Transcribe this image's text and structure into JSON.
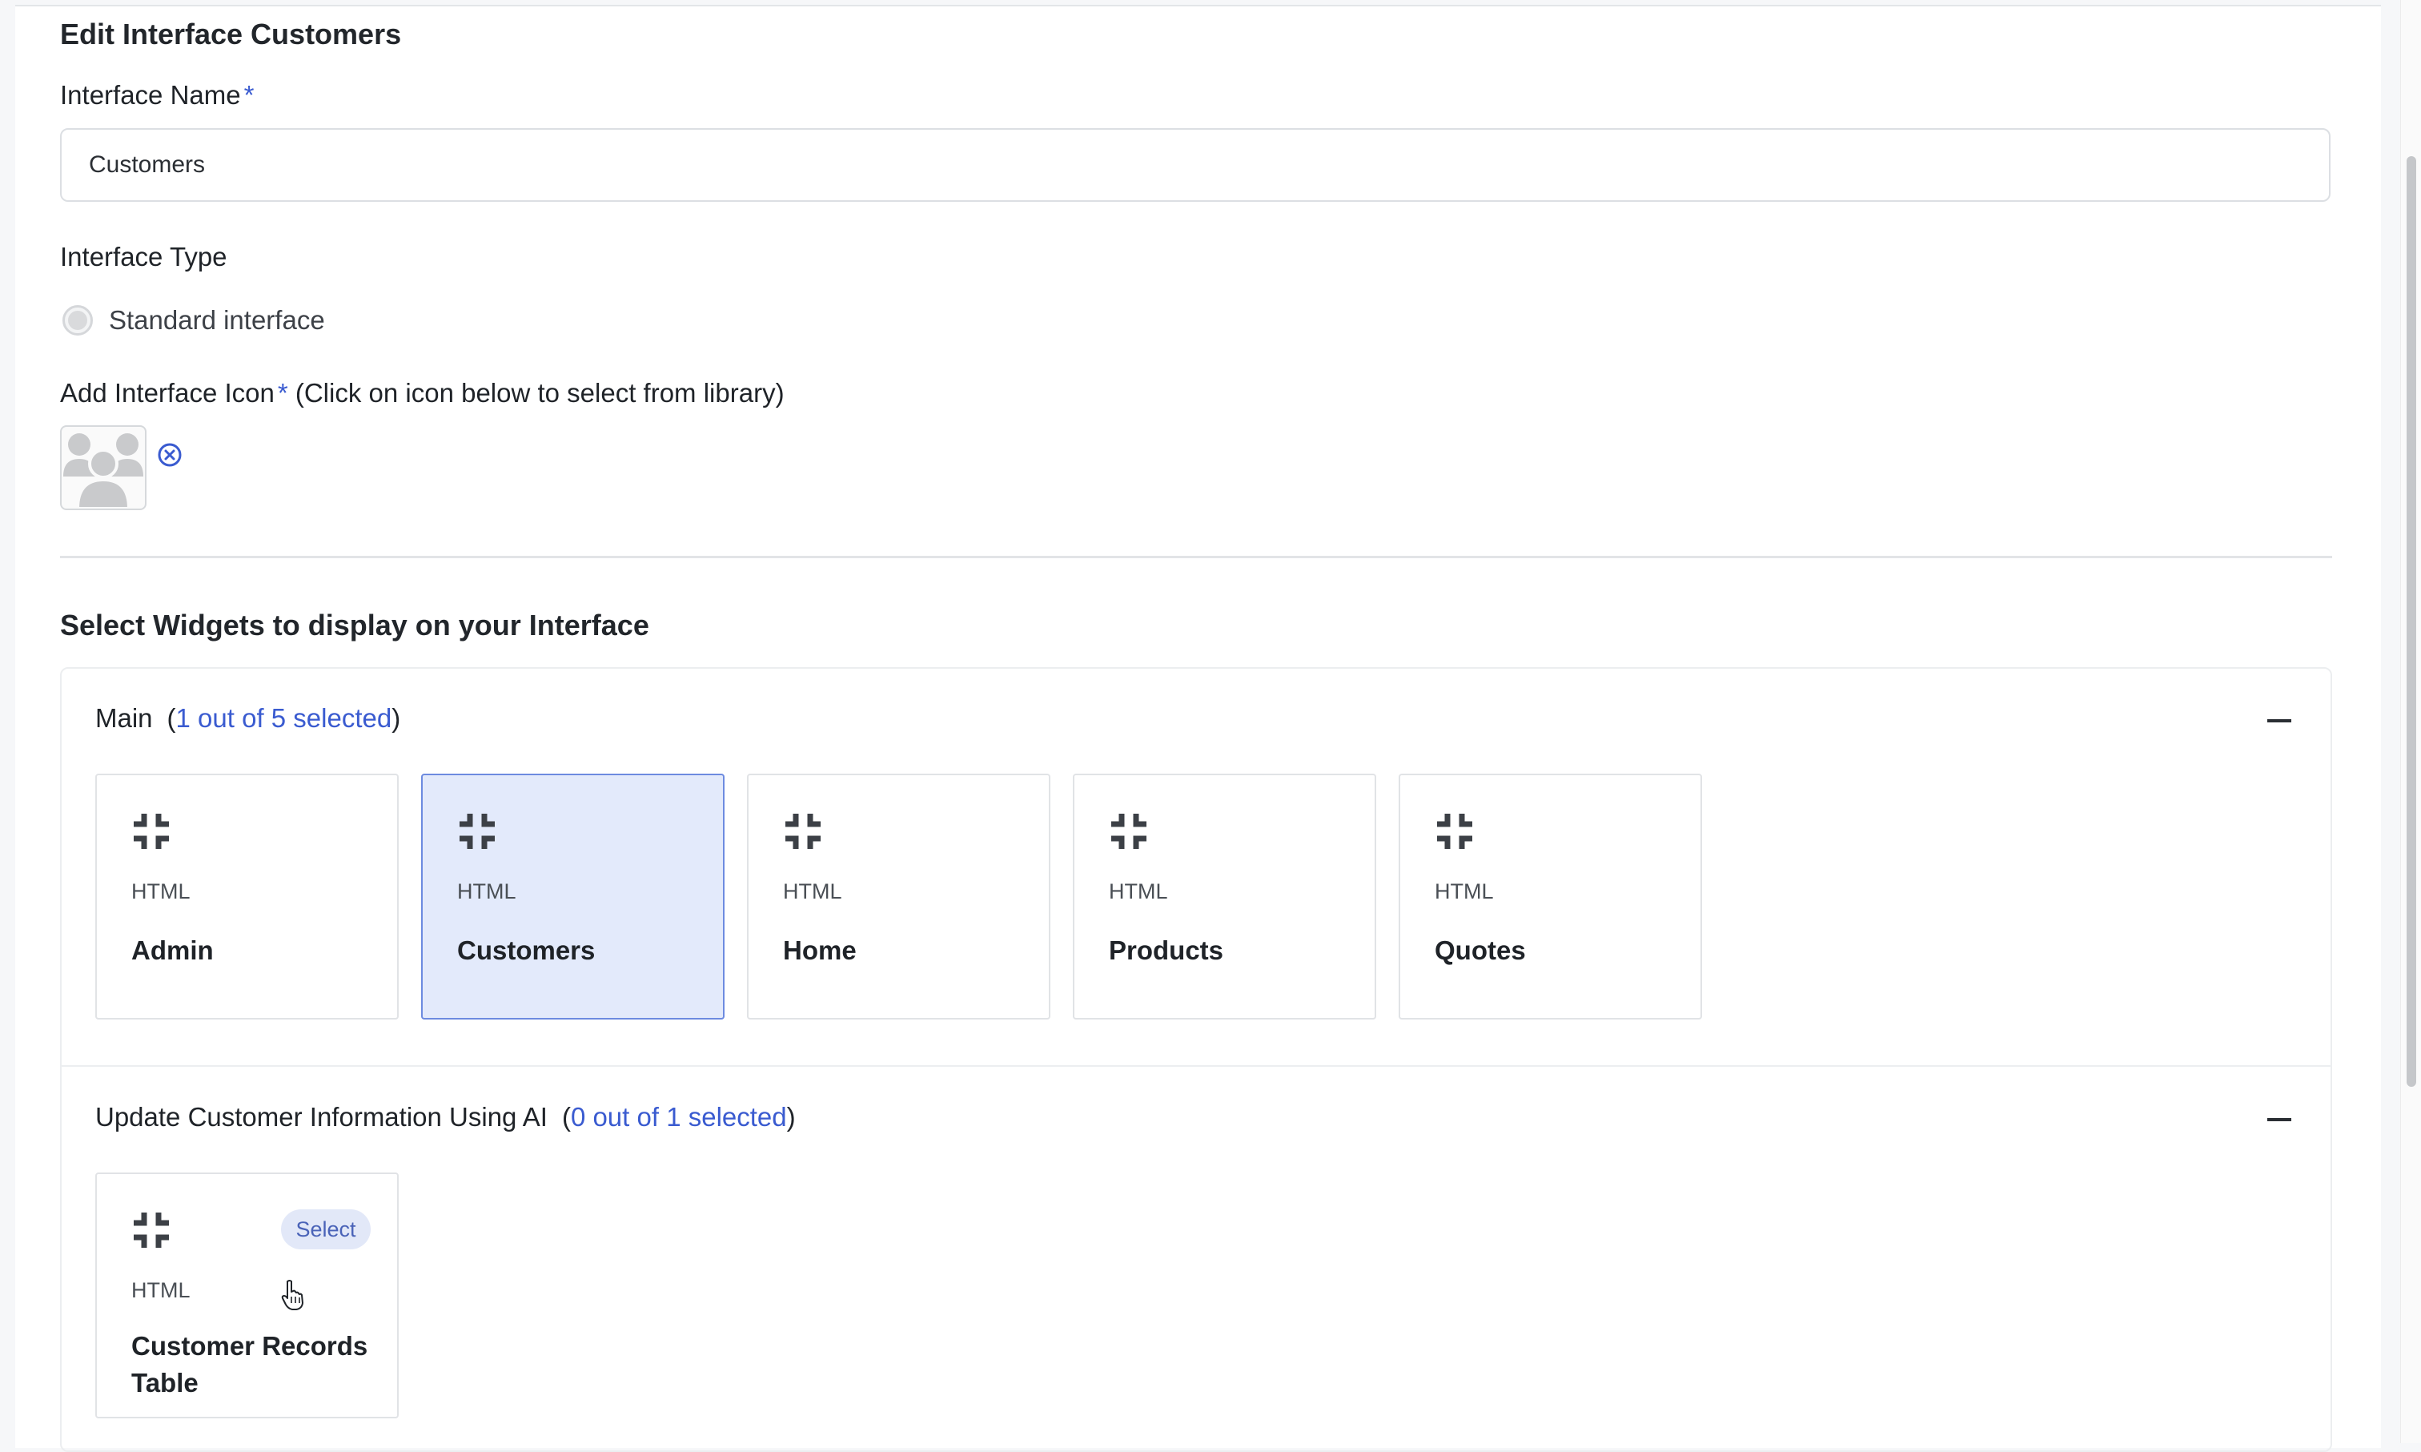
{
  "form": {
    "title": "Edit Interface Customers",
    "name_label": "Interface Name",
    "required_mark": "*",
    "name_value": "Customers",
    "type_label": "Interface Type",
    "type_option": "Standard interface",
    "icon_label": "Add Interface Icon",
    "icon_hint": "(Click on icon below to select from library)",
    "icon": "people-group-icon"
  },
  "widgets": {
    "section_title": "Select Widgets to display on your Interface",
    "accent_color": "#3a5bd0",
    "selected_bg": "#e3eafb",
    "groups": [
      {
        "name": "Main",
        "count": "1 out of 5 selected",
        "items": [
          {
            "type": "HTML",
            "name": "Admin",
            "selected": false
          },
          {
            "type": "HTML",
            "name": "Customers",
            "selected": true
          },
          {
            "type": "HTML",
            "name": "Home",
            "selected": false
          },
          {
            "type": "HTML",
            "name": "Products",
            "selected": false
          },
          {
            "type": "HTML",
            "name": "Quotes",
            "selected": false
          }
        ]
      },
      {
        "name": "Update Customer Information Using AI",
        "count": "0 out of 1 selected",
        "items": [
          {
            "type": "HTML",
            "name": "Customer Records Table",
            "selected": false,
            "select_label": "Select"
          }
        ]
      }
    ]
  }
}
